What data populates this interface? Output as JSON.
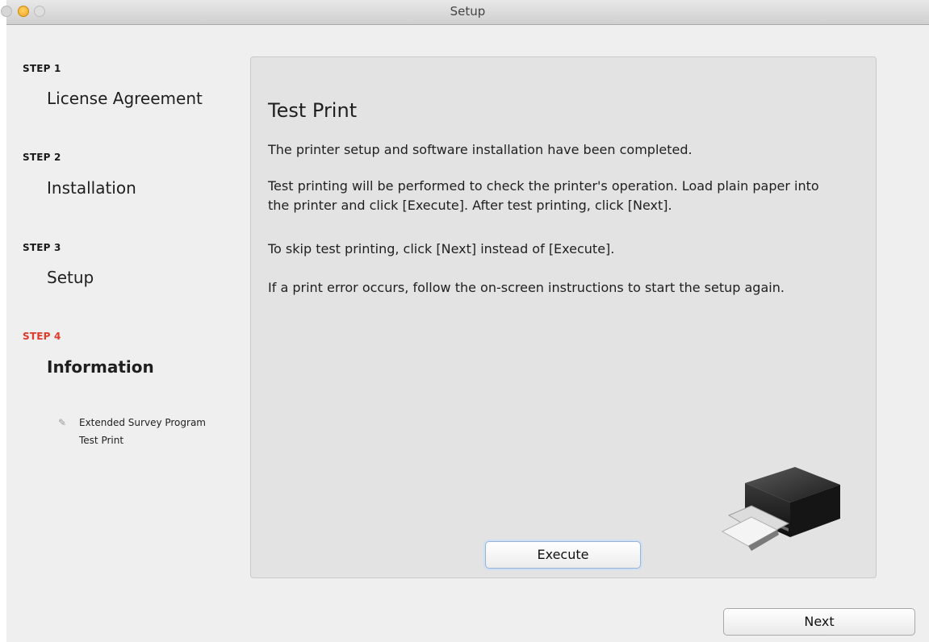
{
  "window": {
    "title": "Setup"
  },
  "sidebar": {
    "steps": [
      {
        "head": "STEP 1",
        "name": "License Agreement"
      },
      {
        "head": "STEP 2",
        "name": "Installation"
      },
      {
        "head": "STEP 3",
        "name": "Setup"
      },
      {
        "head": "STEP 4",
        "name": "Information"
      }
    ],
    "substeps": [
      {
        "label": "Extended Survey Program"
      },
      {
        "label": "Test Print"
      }
    ],
    "active_color": "#e03a2a"
  },
  "main": {
    "title": "Test Print",
    "paragraphs": [
      "The printer setup and software installation have been completed.",
      "Test printing will be performed to check the printer's operation. Load plain paper into the printer and click [Execute]. After test printing, click [Next].",
      "To skip test printing, click [Next] instead of [Execute].",
      "If a print error occurs, follow the on-screen instructions to start the setup again."
    ],
    "execute_label": "Execute",
    "illustration": "printer-icon"
  },
  "footer": {
    "next_label": "Next"
  }
}
